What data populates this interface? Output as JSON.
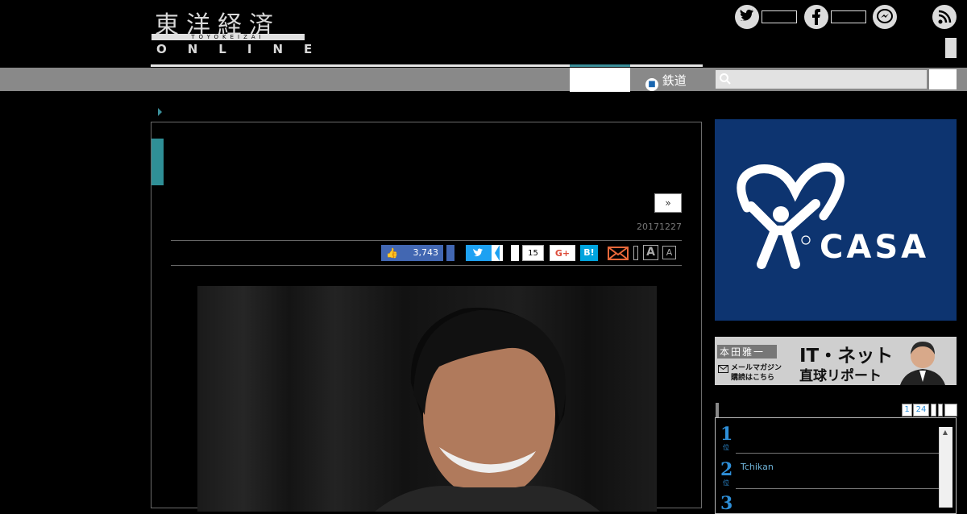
{
  "header": {
    "logo_kanji": "東洋経済",
    "logo_sub": "TOYOKEIZAI",
    "logo_online": "ONLINE"
  },
  "social": {
    "twitter_icon": "twitter-icon",
    "facebook_icon": "facebook-icon",
    "messenger_icon": "messenger-icon",
    "rss_icon": "rss-icon"
  },
  "nav": {
    "rail_label": "鉄道",
    "search_placeholder": ""
  },
  "article": {
    "next_label": "»",
    "date": "20171227",
    "share": {
      "fb_count": "3,743",
      "hatena_count": "15",
      "gplus_label": "G+",
      "hatena_label": "B!",
      "font_large": "A",
      "font_small": "A"
    }
  },
  "sidebar": {
    "ad_brand": "CASA",
    "ad2_name": "本田雅一",
    "ad2_mail": "メールマガジン",
    "ad2_sub": "購読はこちら",
    "ad2_title_1": "IT・ネット",
    "ad2_title_2": "直球リポート",
    "rank_tab_1": "1",
    "rank_tab_2": "24",
    "rank_items": [
      {
        "rank": "1",
        "suffix": "位",
        "text": ""
      },
      {
        "rank": "2",
        "suffix": "位",
        "text": "Tchikan"
      },
      {
        "rank": "3",
        "suffix": "",
        "text": ""
      }
    ]
  },
  "colors": {
    "accent": "#2f8f96",
    "nav_bg": "#898989",
    "fb": "#4267b2",
    "twitter": "#1da1f2",
    "hatena": "#00a4de",
    "ad_bg": "#0d3470",
    "rank_blue": "#2e8fd8"
  }
}
